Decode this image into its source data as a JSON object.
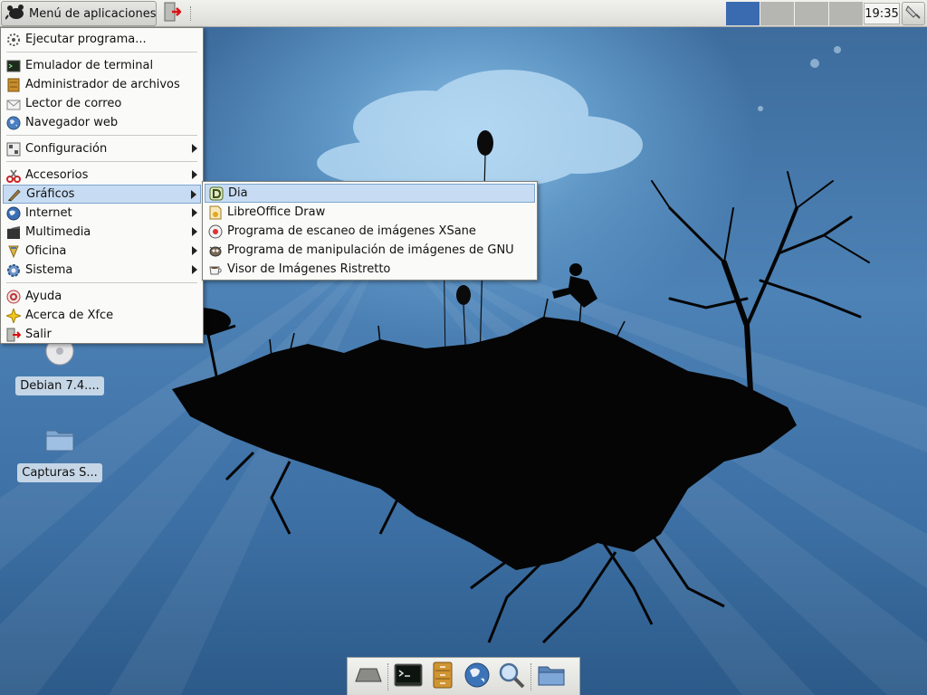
{
  "top_panel": {
    "apps_menu_label": "Menú de aplicaciones",
    "clock": "19:35",
    "workspaces": [
      {
        "active": true
      },
      {
        "active": false
      },
      {
        "active": false
      },
      {
        "active": false
      }
    ]
  },
  "apps_menu": {
    "items": [
      {
        "label": "Ejecutar programa...",
        "icon": "run-icon"
      },
      {
        "label": "Emulador de terminal",
        "icon": "terminal-icon"
      },
      {
        "label": "Administrador de archivos",
        "icon": "file-manager-icon"
      },
      {
        "label": "Lector de correo",
        "icon": "mail-icon"
      },
      {
        "label": "Navegador web",
        "icon": "web-browser-icon"
      },
      {
        "label": "Configuración",
        "icon": "settings-icon",
        "submenu": true
      },
      {
        "label": "Accesorios",
        "icon": "accessories-icon",
        "submenu": true
      },
      {
        "label": "Gráficos",
        "icon": "graphics-icon",
        "submenu": true,
        "highlighted": true
      },
      {
        "label": "Internet",
        "icon": "internet-icon",
        "submenu": true
      },
      {
        "label": "Multimedia",
        "icon": "multimedia-icon",
        "submenu": true
      },
      {
        "label": "Oficina",
        "icon": "office-icon",
        "submenu": true
      },
      {
        "label": "Sistema",
        "icon": "system-icon",
        "submenu": true
      },
      {
        "label": "Ayuda",
        "icon": "help-icon"
      },
      {
        "label": "Acerca de Xfce",
        "icon": "about-icon"
      },
      {
        "label": "Salir",
        "icon": "logout-icon"
      }
    ]
  },
  "graphics_submenu": {
    "items": [
      {
        "label": "Dia",
        "icon": "dia-icon",
        "highlighted": true
      },
      {
        "label": "LibreOffice Draw",
        "icon": "libreoffice-draw-icon"
      },
      {
        "label": "Programa de escaneo de imágenes XSane",
        "icon": "xsane-icon"
      },
      {
        "label": "Programa de manipulación de imágenes de GNU",
        "icon": "gimp-icon"
      },
      {
        "label": "Visor de Imágenes Ristretto",
        "icon": "ristretto-icon"
      }
    ]
  },
  "desktop_icons": [
    {
      "label": "Debian 7.4....",
      "icon": "cdrom-icon"
    },
    {
      "label": "Capturas S...",
      "icon": "folder-icon"
    }
  ],
  "dock": {
    "items": [
      {
        "icon": "show-desktop-icon"
      },
      {
        "icon": "terminal-icon"
      },
      {
        "icon": "file-manager-icon"
      },
      {
        "icon": "web-browser-icon"
      },
      {
        "icon": "search-icon"
      },
      {
        "icon": "folder-icon"
      }
    ]
  },
  "colors": {
    "highlight": "#c7dcf3",
    "active_workspace": "#3a6bb0",
    "desktop": "#3f6f9f"
  }
}
